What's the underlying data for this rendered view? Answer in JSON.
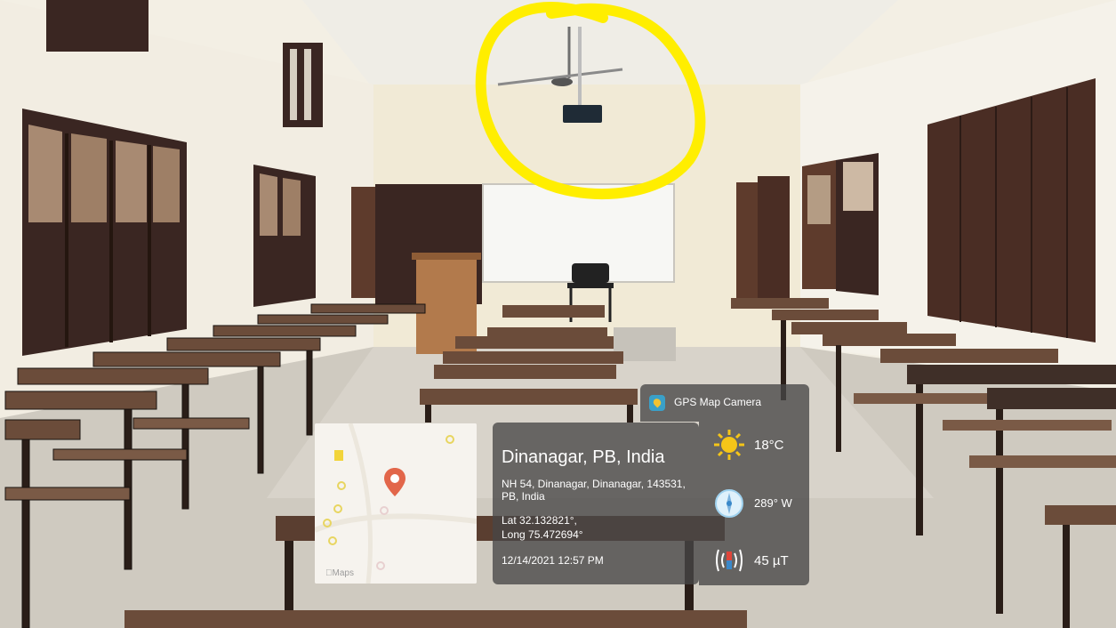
{
  "gps_camera": {
    "app_name": "GPS Map Camera",
    "location_title": "Dinanagar, PB, India",
    "address": "NH 54, Dinanagar, Dinanagar, 143531, PB, India",
    "latitude": "Lat 32.132821°,",
    "longitude": "Long 75.472694°",
    "datetime": "12/14/2021 12:57 PM",
    "map_attribution": "Maps",
    "temperature": "18°C",
    "heading": "289° W",
    "magnetic_field": "45 µT"
  },
  "annotation": {
    "color": "#ffee00"
  },
  "colors": {
    "wall": "#f3efe4",
    "ceiling": "#efede6",
    "floor": "#cfcac0",
    "wood_dark": "#3a2622",
    "wood_medium": "#5e3b2c",
    "desk_top": "#6b4c3a",
    "map_pin": "#e2664a"
  }
}
